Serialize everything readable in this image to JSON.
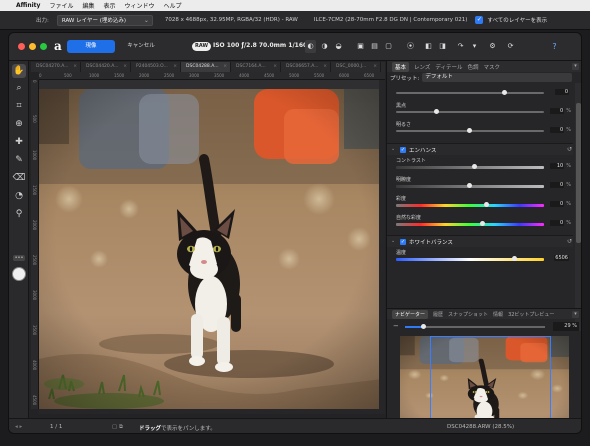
{
  "menubar": {
    "app": "Affinity",
    "items": [
      "ファイル",
      "編集",
      "表示",
      "ウィンドウ",
      "ヘルプ"
    ]
  },
  "output": {
    "label": "出力:",
    "selected": "RAW レイヤー (埋め込み)",
    "meta": "7028 x 4688px, 32.95MP, RGBA/32 (HDR) - RAW",
    "lens": "ILCE-7CM2 (28-70mm F2.8 DG DN | Contemporary 021)",
    "show_all_layers_checked": true,
    "show_all_layers_label": "すべてのレイヤーを表示"
  },
  "toolbar": {
    "develop_label": "現像",
    "cancel_label": "キャンセル",
    "raw_badge": "RAW",
    "exif": "ISO 100 ƒ/2.8 70.0mm 1/1600s",
    "help_icon": "?"
  },
  "tabs": [
    {
      "label": "DSC04270.A..."
    },
    {
      "label": "DSC04420.A..."
    },
    {
      "label": "P2404503.O..."
    },
    {
      "label": "DSC04288.A...",
      "active": true
    },
    {
      "label": "DSC7164.A..."
    },
    {
      "label": "DSC06657.A..."
    },
    {
      "label": "DSC_0000.J..."
    }
  ],
  "ruler": {
    "h": [
      "0",
      "500",
      "1000",
      "1500",
      "2000",
      "2500",
      "3000",
      "3500",
      "4000",
      "4500",
      "5000",
      "5500",
      "6000",
      "6500"
    ],
    "v": [
      "0",
      "500",
      "1000",
      "1500",
      "2000",
      "2500",
      "3000",
      "3500",
      "4000",
      "4500"
    ]
  },
  "panel": {
    "tabs": [
      "基本",
      "レンズ",
      "ディテール",
      "色調",
      "マスク"
    ],
    "active_tab": "基本",
    "preset_label": "プリセット:",
    "preset_value": "デフォルト",
    "rows_top": [
      {
        "label": "",
        "value": "0",
        "unit": "",
        "pos": 0.73
      },
      {
        "label": "黒点",
        "value": "0",
        "unit": "%",
        "pos": 0.27
      },
      {
        "label": "明るさ",
        "value": "0",
        "unit": "%",
        "pos": 0.49
      }
    ],
    "enhance": {
      "title": "エンハンス",
      "checked": true,
      "rows": [
        {
          "label": "コントラスト",
          "value": "10",
          "unit": "%",
          "pos": 0.53,
          "gradient": "gray"
        },
        {
          "label": "明瞭度",
          "value": "0",
          "unit": "%",
          "pos": 0.49,
          "gradient": "gray"
        },
        {
          "label": "彩度",
          "value": "0",
          "unit": "%",
          "pos": 0.61,
          "gradient": "rainbow"
        },
        {
          "label": "自然な彩度",
          "value": "0",
          "unit": "%",
          "pos": 0.58,
          "gradient": "rainbow"
        }
      ]
    },
    "white_balance": {
      "title": "ホワイトバランス",
      "checked": true,
      "rows": [
        {
          "label": "温度",
          "value": "6506",
          "unit": "",
          "pos": 0.8,
          "gradient": "temp"
        }
      ]
    }
  },
  "navigator": {
    "tabs": [
      "ナビゲーター",
      "履歴",
      "スナップショット",
      "情報",
      "32ビットプレビュー"
    ],
    "active_tab": "ナビゲーター",
    "zoom": "29 %",
    "zoom_level": 0.13
  },
  "status": {
    "page": "1 / 1",
    "hint_bold": "ドラッグ",
    "hint": "で表示をパンします。",
    "filename": "DSC04288.ARW (28.5%)"
  },
  "colors": {
    "accent": "#1e6fe8",
    "background": "#232325",
    "panel": "#262628"
  },
  "icons": {
    "tools": [
      "hand-icon",
      "zoom-icon",
      "crop-icon",
      "red-eye-icon",
      "blemish-icon",
      "overlay-paint-icon",
      "overlay-erase-icon",
      "gradient-icon",
      "white-balance-picker-icon"
    ]
  }
}
